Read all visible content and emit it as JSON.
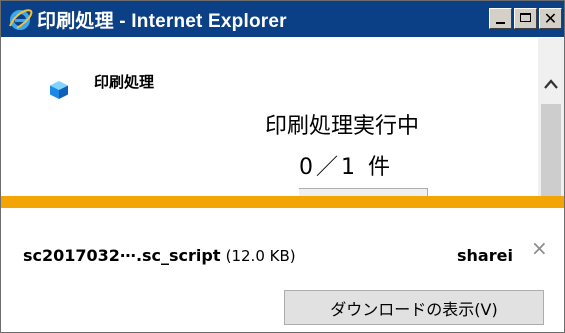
{
  "window": {
    "title": "印刷処理 - Internet Explorer",
    "icon": "internet-explorer-icon"
  },
  "content": {
    "app_title": "印刷処理",
    "app_icon": "cube-icon",
    "status": "印刷処理実行中",
    "progress_count": "0／1 件"
  },
  "download_bar": {
    "file_name": "sc2017032⋯.sc_script",
    "file_size": "(12.0 KB)",
    "site": "sharei",
    "view_button_label": "ダウンロードの表示(V)",
    "accent_color": "#f2a505"
  },
  "colors": {
    "titlebar": "#0b3f86",
    "scrollbar_thumb": "#cdcdcd"
  }
}
